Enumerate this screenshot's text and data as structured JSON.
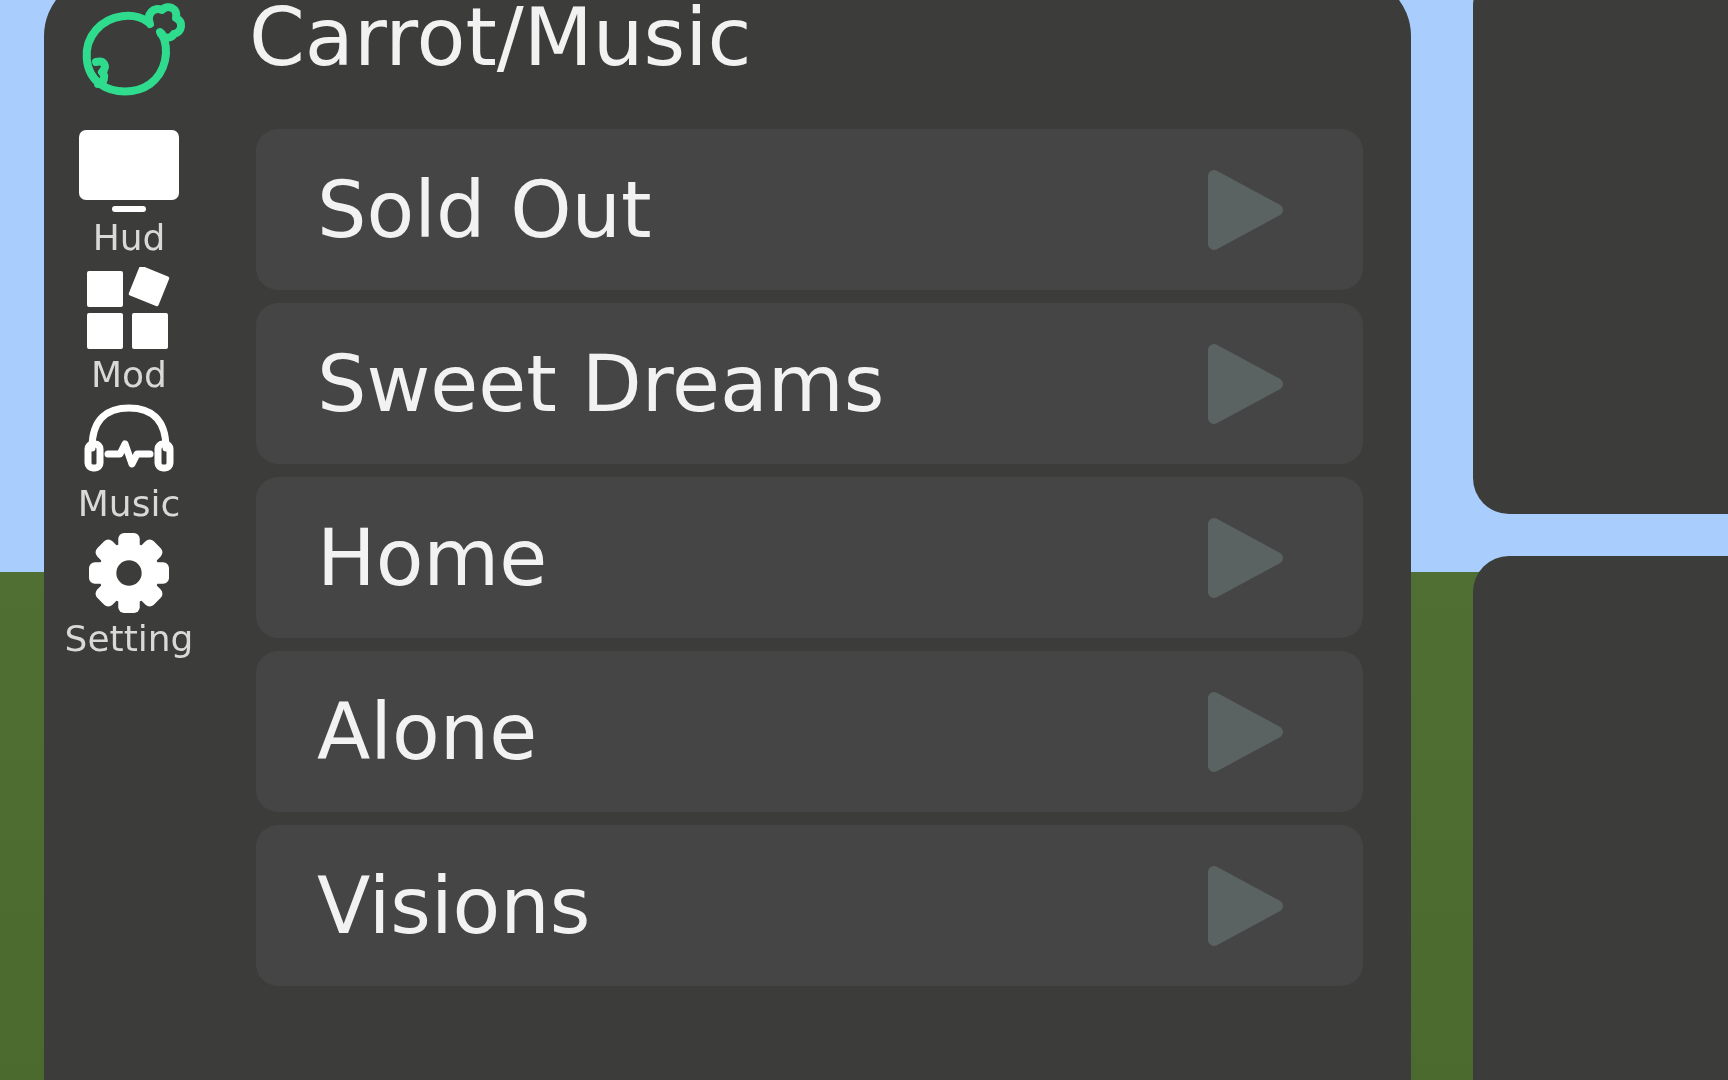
{
  "window": {
    "title": "Carrot/Music"
  },
  "sidebar": {
    "items": [
      {
        "label": "Hud"
      },
      {
        "label": "Mod"
      },
      {
        "label": "Music"
      },
      {
        "label": "Setting"
      }
    ]
  },
  "songs": [
    {
      "title": "Sold Out"
    },
    {
      "title": "Sweet Dreams"
    },
    {
      "title": "Home"
    },
    {
      "title": "Alone"
    },
    {
      "title": "Visions"
    }
  ]
}
